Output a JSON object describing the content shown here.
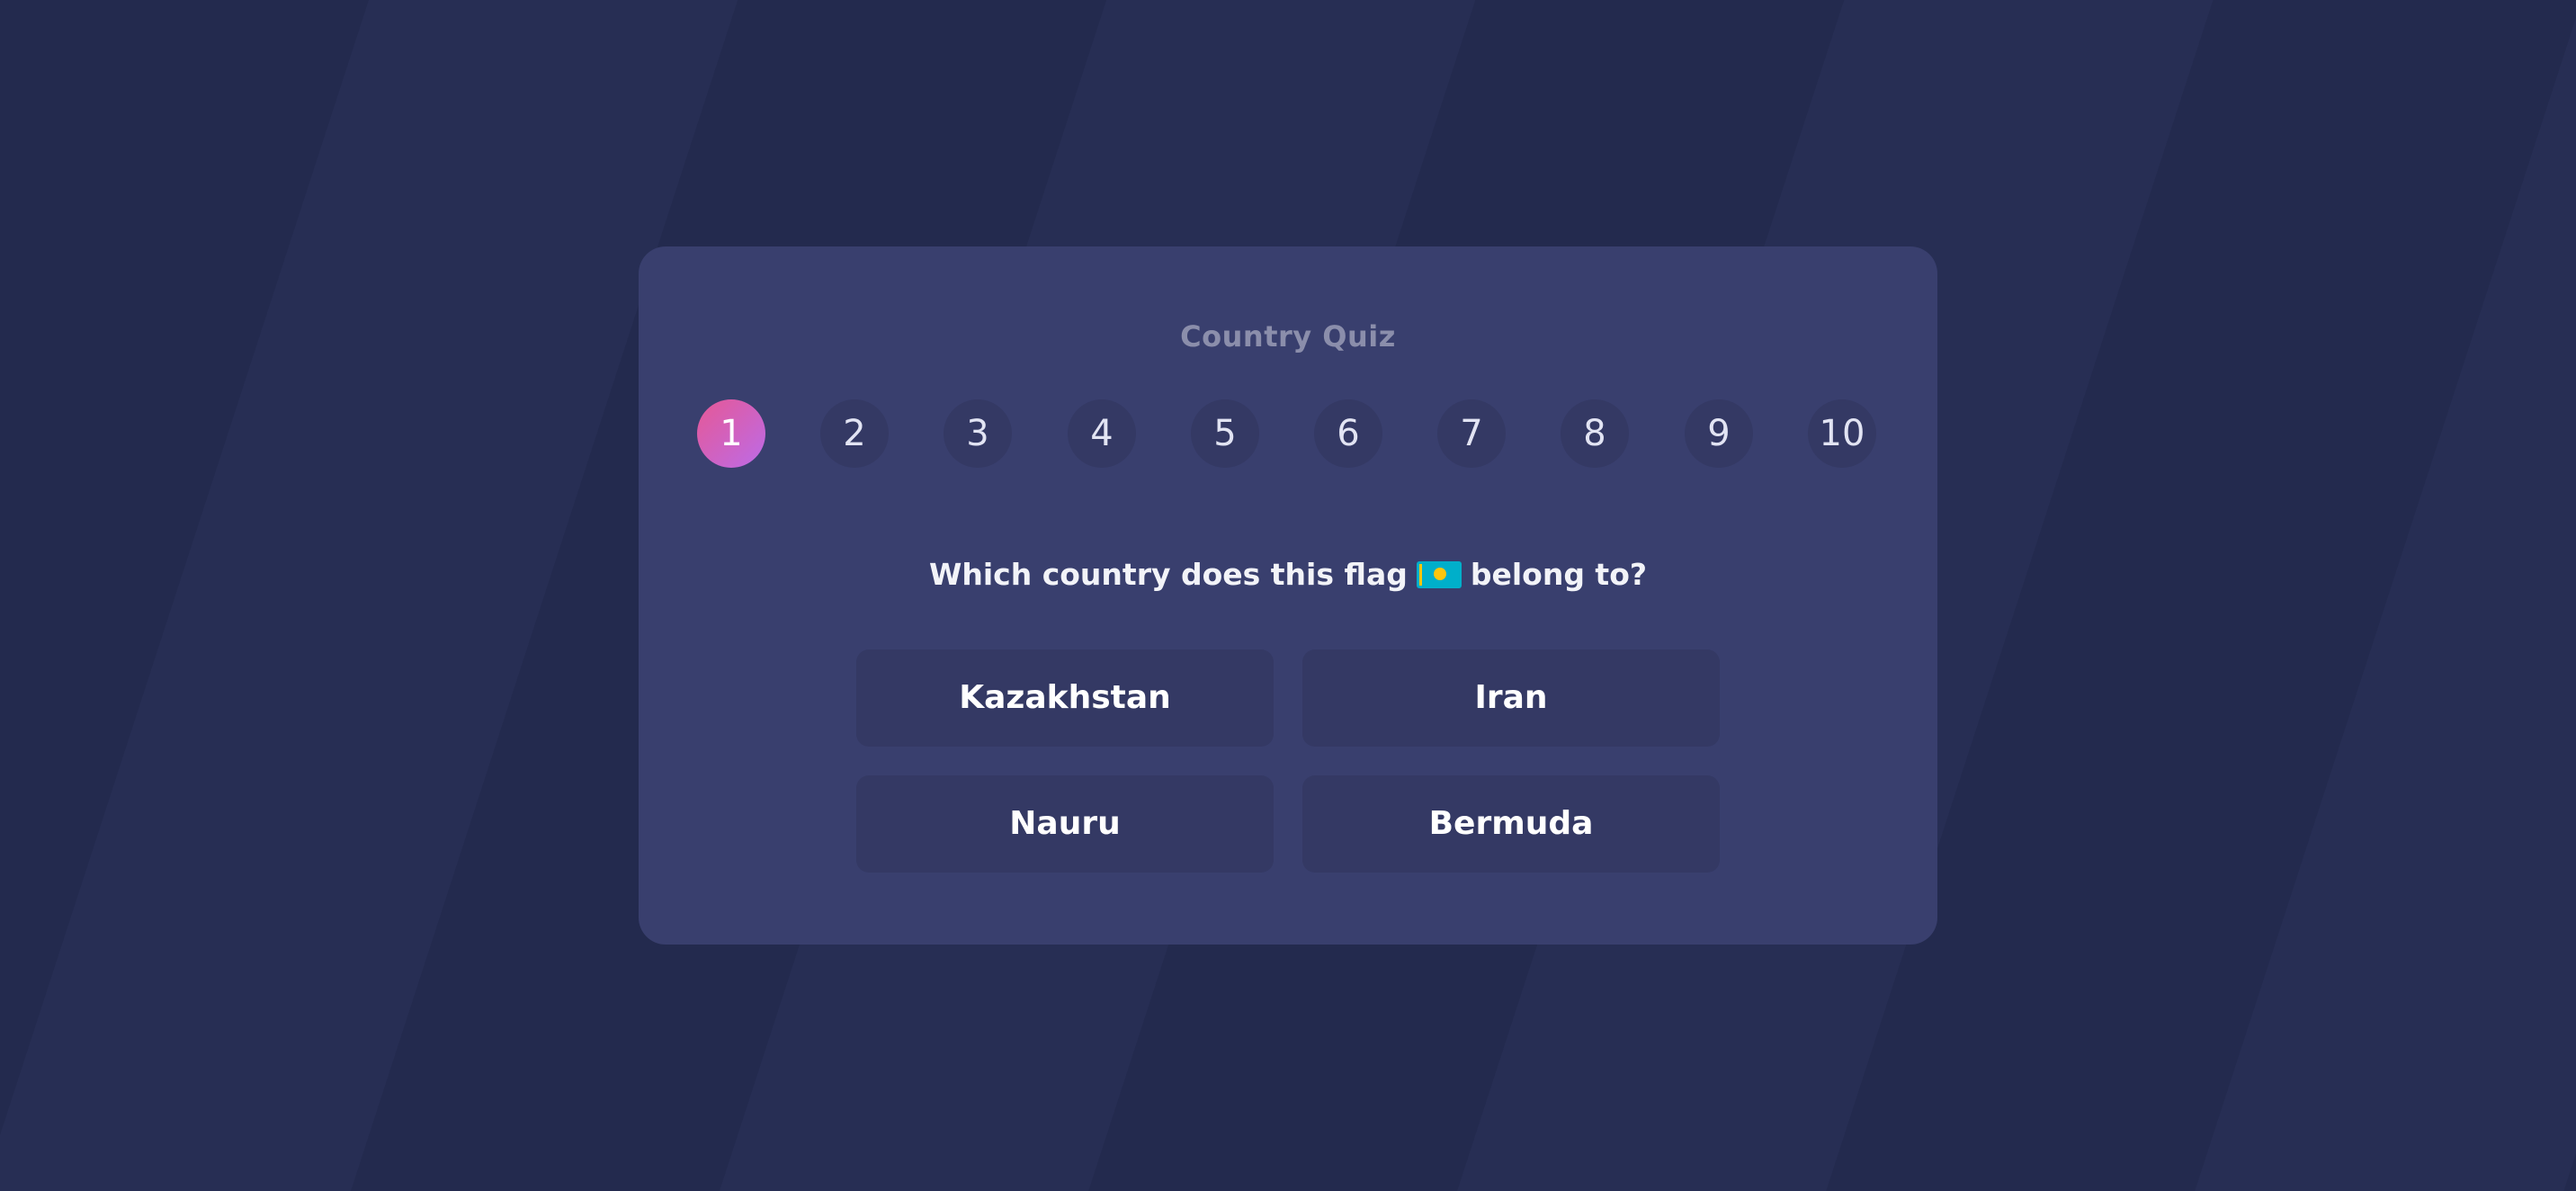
{
  "app": {
    "title": "Country Quiz"
  },
  "steps": [
    "1",
    "2",
    "3",
    "4",
    "5",
    "6",
    "7",
    "8",
    "9",
    "10"
  ],
  "current_step": 1,
  "question": {
    "prefix": "Which country does this flag",
    "flag_icon": "kazakhstan-flag-icon",
    "suffix": "belong to?"
  },
  "answers": [
    "Kazakhstan",
    "Iran",
    "Nauru",
    "Bermuda"
  ],
  "colors": {
    "background": "#252b50",
    "card": "#393f6e",
    "step_bg": "#343964",
    "active_gradient_start": "#e65895",
    "active_gradient_end": "#bc6be8",
    "title_text": "#8b8eab",
    "answer_bg": "#343964"
  }
}
